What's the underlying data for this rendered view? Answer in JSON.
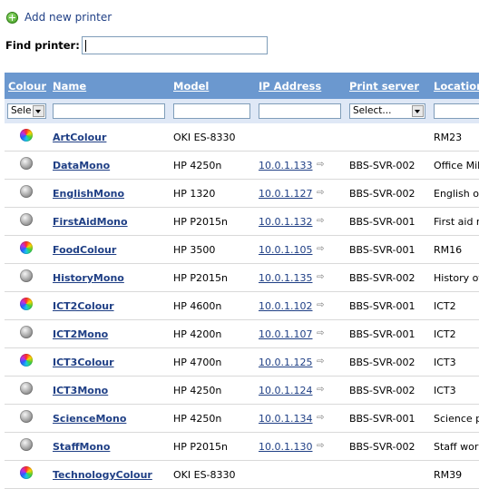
{
  "add_printer_label": "Add new printer",
  "find_label": "Find printer:",
  "find_value": "",
  "columns": {
    "colour": "Colour",
    "name": "Name",
    "model": "Model",
    "ip": "IP Address",
    "server": "Print server",
    "location": "Location"
  },
  "filters": {
    "colour_select": "Sele",
    "server_select": "Select..."
  },
  "printers": [
    {
      "type": "colour",
      "name": "ArtColour",
      "model": "OKI ES-8330",
      "ip": "",
      "server": "",
      "location": "RM23"
    },
    {
      "type": "mono",
      "name": "DataMono",
      "model": "HP 4250n",
      "ip": "10.0.1.133",
      "server": "BBS-SVR-002",
      "location": "Office Mik"
    },
    {
      "type": "mono",
      "name": "EnglishMono",
      "model": "HP 1320",
      "ip": "10.0.1.127",
      "server": "BBS-SVR-002",
      "location": "English o"
    },
    {
      "type": "mono",
      "name": "FirstAidMono",
      "model": "HP P2015n",
      "ip": "10.0.1.132",
      "server": "BBS-SVR-001",
      "location": "First aid r"
    },
    {
      "type": "colour",
      "name": "FoodColour",
      "model": "HP 3500",
      "ip": "10.0.1.105",
      "server": "BBS-SVR-001",
      "location": "RM16"
    },
    {
      "type": "mono",
      "name": "HistoryMono",
      "model": "HP P2015n",
      "ip": "10.0.1.135",
      "server": "BBS-SVR-002",
      "location": "History of"
    },
    {
      "type": "colour",
      "name": "ICT2Colour",
      "model": "HP 4600n",
      "ip": "10.0.1.102",
      "server": "BBS-SVR-001",
      "location": "ICT2"
    },
    {
      "type": "mono",
      "name": "ICT2Mono",
      "model": "HP 4200n",
      "ip": "10.0.1.107",
      "server": "BBS-SVR-001",
      "location": "ICT2"
    },
    {
      "type": "colour",
      "name": "ICT3Colour",
      "model": "HP 4700n",
      "ip": "10.0.1.125",
      "server": "BBS-SVR-002",
      "location": "ICT3"
    },
    {
      "type": "mono",
      "name": "ICT3Mono",
      "model": "HP 4250n",
      "ip": "10.0.1.124",
      "server": "BBS-SVR-002",
      "location": "ICT3"
    },
    {
      "type": "mono",
      "name": "ScienceMono",
      "model": "HP 4250n",
      "ip": "10.0.1.134",
      "server": "BBS-SVR-001",
      "location": "Science p"
    },
    {
      "type": "mono",
      "name": "StaffMono",
      "model": "HP P2015n",
      "ip": "10.0.1.130",
      "server": "BBS-SVR-002",
      "location": "Staff wor"
    },
    {
      "type": "colour",
      "name": "TechnologyColour",
      "model": "OKI ES-8330",
      "ip": "",
      "server": "",
      "location": "RM39"
    }
  ]
}
